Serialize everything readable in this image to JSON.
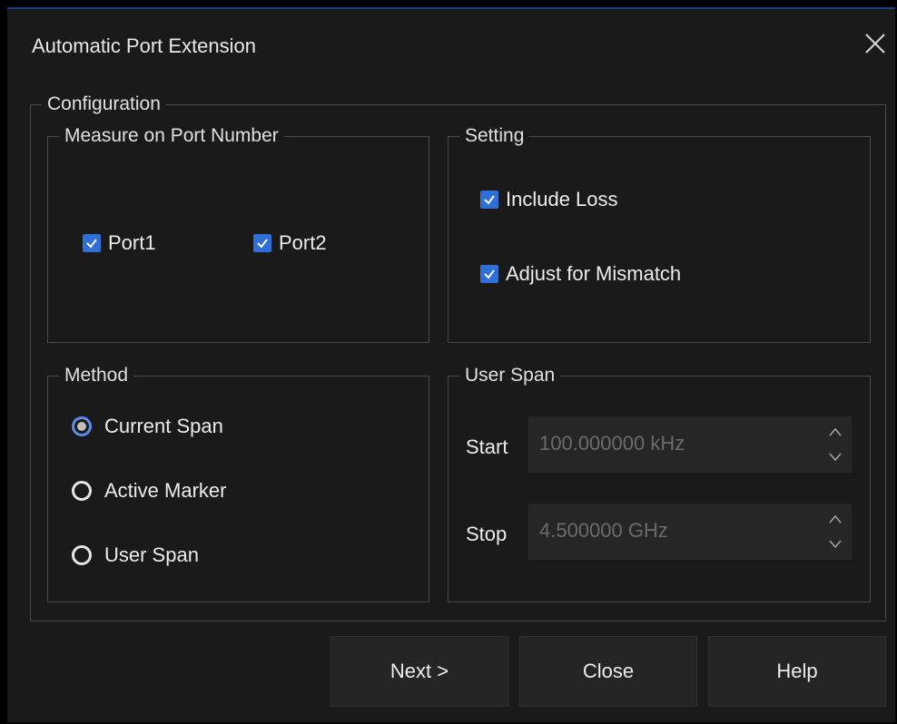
{
  "dialog": {
    "title": "Automatic Port Extension"
  },
  "configuration": {
    "label": "Configuration",
    "measure": {
      "label": "Measure on Port Number",
      "ports": [
        {
          "label": "Port1",
          "checked": true
        },
        {
          "label": "Port2",
          "checked": true
        }
      ]
    },
    "setting": {
      "label": "Setting",
      "options": [
        {
          "label": "Include Loss",
          "checked": true
        },
        {
          "label": "Adjust for Mismatch",
          "checked": true
        }
      ]
    },
    "method": {
      "label": "Method",
      "options": [
        {
          "label": "Current Span",
          "selected": true
        },
        {
          "label": "Active Marker",
          "selected": false
        },
        {
          "label": "User Span",
          "selected": false
        }
      ]
    },
    "user_span": {
      "label": "User Span",
      "start": {
        "label": "Start",
        "value": "100.000000 kHz"
      },
      "stop": {
        "label": "Stop",
        "value": "4.500000 GHz"
      }
    }
  },
  "buttons": {
    "next": "Next >",
    "close": "Close",
    "help": "Help"
  },
  "colors": {
    "accent": "#2f6fd8",
    "background": "#1a1a1a",
    "border": "#4a4a4a"
  }
}
